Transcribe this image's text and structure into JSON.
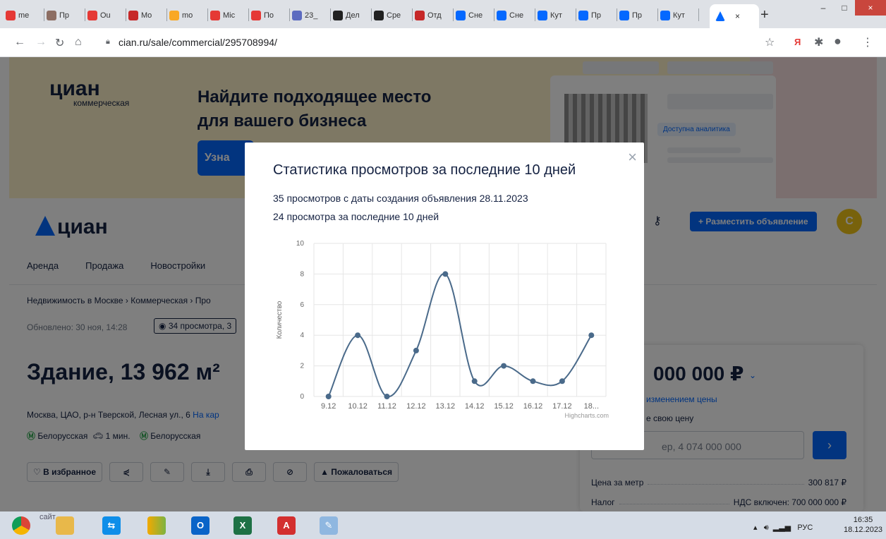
{
  "browser": {
    "tabs": [
      {
        "label": "me",
        "color": "#e53935"
      },
      {
        "label": "Пр",
        "color": "#8d6e63"
      },
      {
        "label": "Ou",
        "color": "#e53935"
      },
      {
        "label": "Mo",
        "color": "#c62828"
      },
      {
        "label": "mo",
        "color": "#f9a825"
      },
      {
        "label": "Mic",
        "color": "#e53935"
      },
      {
        "label": "По",
        "color": "#e53935"
      },
      {
        "label": "23_",
        "color": "#5c6bc0"
      },
      {
        "label": "Дел",
        "color": "#212121"
      },
      {
        "label": "Сре",
        "color": "#212121"
      },
      {
        "label": "Отд",
        "color": "#c62828"
      },
      {
        "label": "Сне",
        "color": "#0468ff"
      },
      {
        "label": "Сне",
        "color": "#0468ff"
      },
      {
        "label": "Кут",
        "color": "#0468ff"
      },
      {
        "label": "Пр",
        "color": "#0468ff"
      },
      {
        "label": "Пр",
        "color": "#0468ff"
      },
      {
        "label": "Кут",
        "color": "#0468ff"
      }
    ],
    "active_tab_close": "×",
    "new_tab": "+",
    "url": "cian.ru/sale/commercial/295708994/",
    "window_buttons": {
      "minimize": "–",
      "maximize": "□",
      "close": "×"
    }
  },
  "banner": {
    "logo": "циан",
    "logo_sub": "коммерческая",
    "title_line1": "Найдите подходящее место",
    "title_line2": "для вашего бизнеса",
    "button": "Узна",
    "analytics_badge": "Доступна аналитика"
  },
  "header": {
    "logo": "циан",
    "menu": [
      "Аренда",
      "Продажа",
      "Новостройки"
    ],
    "post_button": "+ Разместить объявление",
    "avatar": "С"
  },
  "listing": {
    "breadcrumb": "Недвижимость в Москве  ›  Коммерческая  ›  Про",
    "updated": "Обновлено: 30 ноя, 14:28",
    "views_link": "34 просмотра, 3",
    "title": "Здание, 13 962 м²",
    "address": "Москва, ЦАО, р-н Тверской, Лесная ул., 6",
    "map_link": "На кар",
    "metro1": "Белорусская",
    "metro1_time": "1 мин.",
    "metro2": "Белорусская",
    "favorite_button": "В избранное",
    "complain_button": "Пожаловаться"
  },
  "price_card": {
    "price": "000 000 ₽",
    "watch": "изменением цены",
    "offer_label": "е свою цену",
    "offer_placeholder": "ер, 4 074 000 000",
    "rows": [
      {
        "label": "Цена за метр",
        "value": "300 817 ₽"
      },
      {
        "label": "Налог",
        "value": "НДС включен: 700 000 000 ₽"
      }
    ]
  },
  "modal": {
    "title": "Статистика просмотров за последние 10 дней",
    "line1": "35 просмотров с даты создания объявления 28.11.2023",
    "line2": "24 просмотра за последние 10 дней",
    "close": "×"
  },
  "chart_data": {
    "type": "line",
    "categories": [
      "9.12",
      "10.12",
      "11.12",
      "12.12",
      "13.12",
      "14.12",
      "15.12",
      "16.12",
      "17.12",
      "18..."
    ],
    "values": [
      0,
      4,
      0,
      3,
      8,
      1,
      2,
      1,
      1,
      4
    ],
    "ylabel": "Количество",
    "ylim": [
      0,
      10
    ],
    "yticks": [
      0,
      2,
      4,
      6,
      8,
      10
    ],
    "credit": "Highcharts.com",
    "color": "#4a6a8a",
    "grid": true
  },
  "taskbar": {
    "behind_text": "сайт",
    "tray_lang": "РУС",
    "time": "16:35",
    "date": "18.12.2023"
  }
}
